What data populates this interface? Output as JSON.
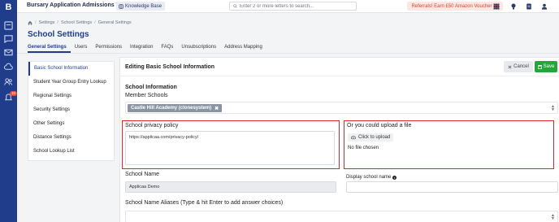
{
  "app": {
    "title": "Bursary Application Admissions Y...",
    "logo_letter": "B",
    "notification_count": "10"
  },
  "topbar": {
    "knowledge_base_label": "Knowledge Base",
    "search_placeholder": "Enter 2 or more letters to search...",
    "referral_label": "Referrals! Earn £50 Amazon Voucher"
  },
  "breadcrumb": {
    "items": [
      "Settings",
      "School Settings",
      "General Settings"
    ],
    "separator": "/"
  },
  "page": {
    "title": "School Settings"
  },
  "tabs": [
    {
      "label": "General Settings",
      "active": true
    },
    {
      "label": "Users"
    },
    {
      "label": "Permissions"
    },
    {
      "label": "Integration"
    },
    {
      "label": "FAQs"
    },
    {
      "label": "Unsubscriptions"
    },
    {
      "label": "Address Mapping"
    }
  ],
  "sidenav": {
    "items": [
      {
        "label": "Basic School Information",
        "active": true
      },
      {
        "label": "Student Year Group Entry Lookup"
      },
      {
        "label": "Regional Settings"
      },
      {
        "label": "Security Settings"
      },
      {
        "label": "Other Settings"
      },
      {
        "label": "Distance Settings"
      },
      {
        "label": "School Lookup List"
      }
    ]
  },
  "form": {
    "heading": "Editing Basic School Information",
    "cancel_label": "Cancel",
    "save_label": "Save",
    "section_title": "School Information",
    "member_schools_label": "Member Schools",
    "member_schools": [
      "Castle Hill Academy (clonesystem)"
    ],
    "privacy_label": "School privacy policy",
    "privacy_value": "https://applicaa.com/privacy-policy/",
    "upload_label": "Or you could upload a file",
    "upload_button": "Click to upload",
    "upload_status": "No file chosen",
    "school_name_label": "School Name",
    "school_name_value": "Applicaa Demo",
    "display_name_label": "Display school name",
    "display_name_value": "",
    "aliases_label": "School Name Aliases (Type & hit Enter to add answer choices)"
  },
  "colors": {
    "rail": "#1f3d8a",
    "accent": "#1f3d8a",
    "save": "#26a63a",
    "highlight": "#e0242c",
    "referral_text": "#d9442c"
  }
}
